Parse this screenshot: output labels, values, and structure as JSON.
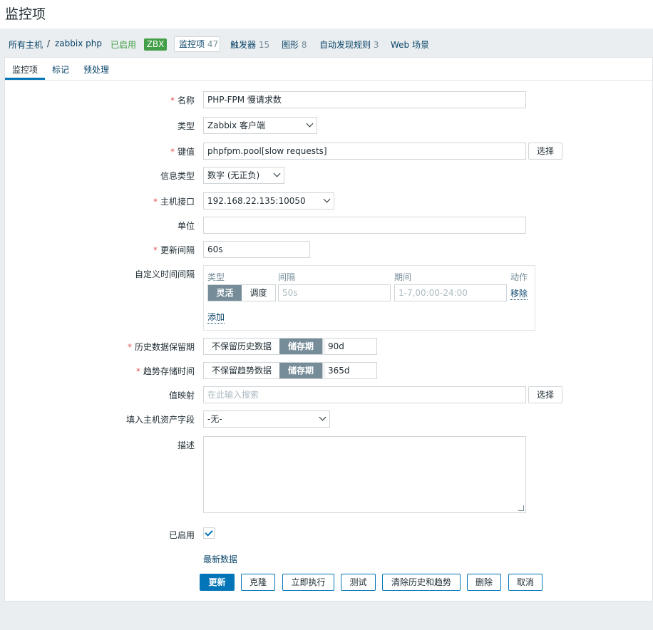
{
  "page": {
    "title": "监控项"
  },
  "breadcrumb": {
    "all_hosts": "所有主机",
    "sep": "/",
    "host": "zabbix php",
    "status": "已启用",
    "zbx": "ZBX",
    "items": {
      "label": "监控项",
      "count": "47"
    },
    "triggers": {
      "label": "触发器",
      "count": "15"
    },
    "graphs": {
      "label": "图形",
      "count": "8"
    },
    "discovery": {
      "label": "自动发现规则",
      "count": "3"
    },
    "web": {
      "label": "Web 场景"
    }
  },
  "tabs": [
    "监控项",
    "标记",
    "预处理"
  ],
  "form": {
    "name": {
      "label": "名称",
      "value": "PHP-FPM 慢请求数"
    },
    "type": {
      "label": "类型",
      "value": "Zabbix 客户端"
    },
    "key": {
      "label": "键值",
      "value": "phpfpm.pool[slow requests]",
      "button": "选择"
    },
    "info_type": {
      "label": "信息类型",
      "value": "数字 (无正负)"
    },
    "interface": {
      "label": "主机接口",
      "value": "192.168.22.135:10050"
    },
    "units": {
      "label": "单位",
      "value": ""
    },
    "update_interval": {
      "label": "更新间隔",
      "value": "60s"
    },
    "custom_intervals": {
      "label": "自定义时间间隔",
      "headers": {
        "type": "类型",
        "interval": "间隔",
        "period": "期间",
        "action": "动作"
      },
      "row": {
        "flexible": "灵活",
        "scheduling": "调度",
        "interval_placeholder": "50s",
        "period_placeholder": "1-7,00:00-24:00",
        "remove": "移除"
      },
      "add": "添加"
    },
    "history": {
      "label": "历史数据保留期",
      "off": "不保留历史数据",
      "on": "储存期",
      "value": "90d"
    },
    "trends": {
      "label": "趋势存储时间",
      "off": "不保留趋势数据",
      "on": "储存期",
      "value": "365d"
    },
    "valuemap": {
      "label": "值映射",
      "placeholder": "在此输入搜索",
      "button": "选择"
    },
    "inventory": {
      "label": "填入主机资产字段",
      "value": "-无-"
    },
    "description": {
      "label": "描述",
      "value": ""
    },
    "enabled": {
      "label": "已启用"
    },
    "latest_data": "最新数据"
  },
  "buttons": {
    "update": "更新",
    "clone": "克隆",
    "execute": "立即执行",
    "test": "测试",
    "clear": "清除历史和趋势",
    "delete": "删除",
    "cancel": "取消"
  },
  "colors": {
    "primary": "#0275b8",
    "required": "#e45959",
    "enabled": "#429e47",
    "link": "#0a466a"
  }
}
